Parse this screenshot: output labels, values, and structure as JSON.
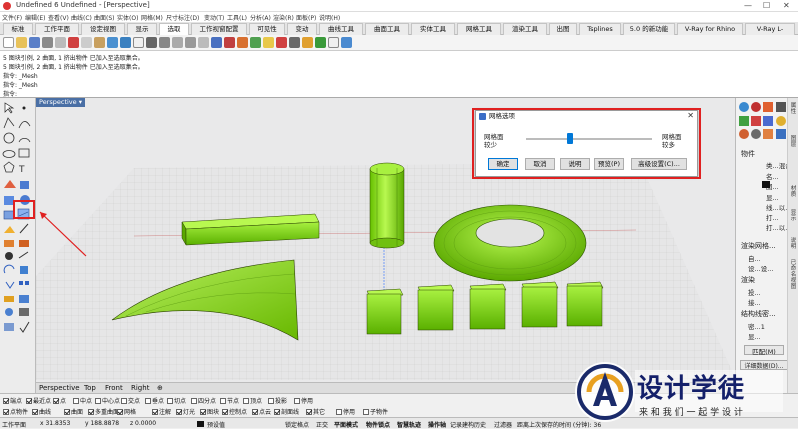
{
  "window": {
    "title": "Undefined 6 Undefined - [Perspective]",
    "controls": [
      "—",
      "☐",
      "✕"
    ]
  },
  "menu": [
    "文件(F)",
    "编辑(E)",
    "查看(V)",
    "曲线(C)",
    "曲面(S)",
    "实体(O)",
    "网格(M)",
    "尺寸标注(D)",
    "变动(T)",
    "工具(L)",
    "分析(A)",
    "渲染(R)",
    "面板(P)",
    "说明(H)"
  ],
  "tabs": [
    "标准",
    "工作平面",
    "设定视图",
    "显示",
    "选取",
    "工作视窗配置",
    "可见性",
    "变动",
    "曲线工具",
    "曲面工具",
    "实体工具",
    "网格工具",
    "渲染工具",
    "出图",
    "Tsplines",
    "5.0 的新功能",
    "V-Ray for Rhino",
    "V-Ray L-"
  ],
  "active_tab": "选取",
  "command_history": [
    "5 图块引例, 2 曲面, 1 挤出物件 已加入至选取集合。",
    "5 图块引例, 2 曲面, 1 挤出物件 已加入至选取集合。",
    "指令: _Mesh",
    "指令: _Mesh",
    "指令:"
  ],
  "viewport": {
    "name": "Perspective",
    "dropdown": "▾"
  },
  "dialog": {
    "title": "网格选项",
    "left_label_line1": "网格面",
    "left_label_line2": "较少",
    "right_label_line1": "网格面",
    "right_label_line2": "较多",
    "slider_value": 0.35,
    "buttons": [
      "确定",
      "取消",
      "说明",
      "预览(P)",
      "高级设置(C)..."
    ]
  },
  "right_panel": {
    "section_object": "物件",
    "rows": [
      "类...混合",
      "名...",
      "图...",
      "显...",
      "线...以...",
      "打...",
      "打...以..."
    ],
    "section_render_mesh": "渲染网格...",
    "render_mesh_rows": [
      "自...",
      "设...设..."
    ],
    "section_render": "渲染",
    "render_rows": [
      "投...",
      "接..."
    ],
    "section_structure": "结构线密...",
    "structure_rows": [
      "密...1",
      "显..."
    ],
    "match_button": "匹配(M)",
    "detail_button": "详细数据(D)..."
  },
  "side_tabs": [
    "属性",
    "图层",
    "材质",
    "显示",
    "说明",
    "已命名视图"
  ],
  "view_tabs": [
    "Perspective",
    "Top",
    "Front",
    "Right",
    "⊕"
  ],
  "osnap_row": [
    {
      "label": "端点",
      "on": true
    },
    {
      "label": "最近点",
      "on": true
    },
    {
      "label": "点",
      "on": true
    },
    {
      "label": "中点",
      "on": false
    },
    {
      "label": "中心点",
      "on": false
    },
    {
      "label": "交点",
      "on": false
    },
    {
      "label": "垂点",
      "on": false
    },
    {
      "label": "切点",
      "on": false
    },
    {
      "label": "四分点",
      "on": false
    },
    {
      "label": "节点",
      "on": false
    },
    {
      "label": "顶点",
      "on": false
    },
    {
      "label": "投影",
      "on": false
    },
    {
      "label": "停用",
      "on": false
    }
  ],
  "filter_row": [
    {
      "label": "点物件",
      "on": true
    },
    {
      "label": "曲线",
      "on": true
    },
    {
      "label": "曲面",
      "on": true
    },
    {
      "label": "多重曲面",
      "on": true
    },
    {
      "label": "网格",
      "on": true
    },
    {
      "label": "注解",
      "on": true
    },
    {
      "label": "灯光",
      "on": true
    },
    {
      "label": "图块",
      "on": true
    },
    {
      "label": "控制点",
      "on": true
    },
    {
      "label": "点云",
      "on": true
    },
    {
      "label": "剖面线",
      "on": true
    },
    {
      "label": "其它",
      "on": true
    },
    {
      "label": "停用",
      "on": false
    },
    {
      "label": "子物件",
      "on": false
    }
  ],
  "status": {
    "plane": "工作平面",
    "x": "x 31.8353",
    "y": "y 188.8878",
    "z": "z 0.0000",
    "layer": "预设值",
    "items": [
      "锁定格点",
      "正交",
      "平面模式",
      "物件锁点",
      "智慧轨迹",
      "操作轴",
      "记录建构历史",
      "过滤器",
      "距离上次保存的时间 (分钟): 36"
    ]
  },
  "watermark": {
    "title": "设计学徒",
    "subtitle": "来 和 我 们 一 起 学 设 计"
  },
  "colors": {
    "object_green": "#8fe000",
    "highlight_red": "#e02020",
    "viewport_bg": "#e9e9ea"
  }
}
